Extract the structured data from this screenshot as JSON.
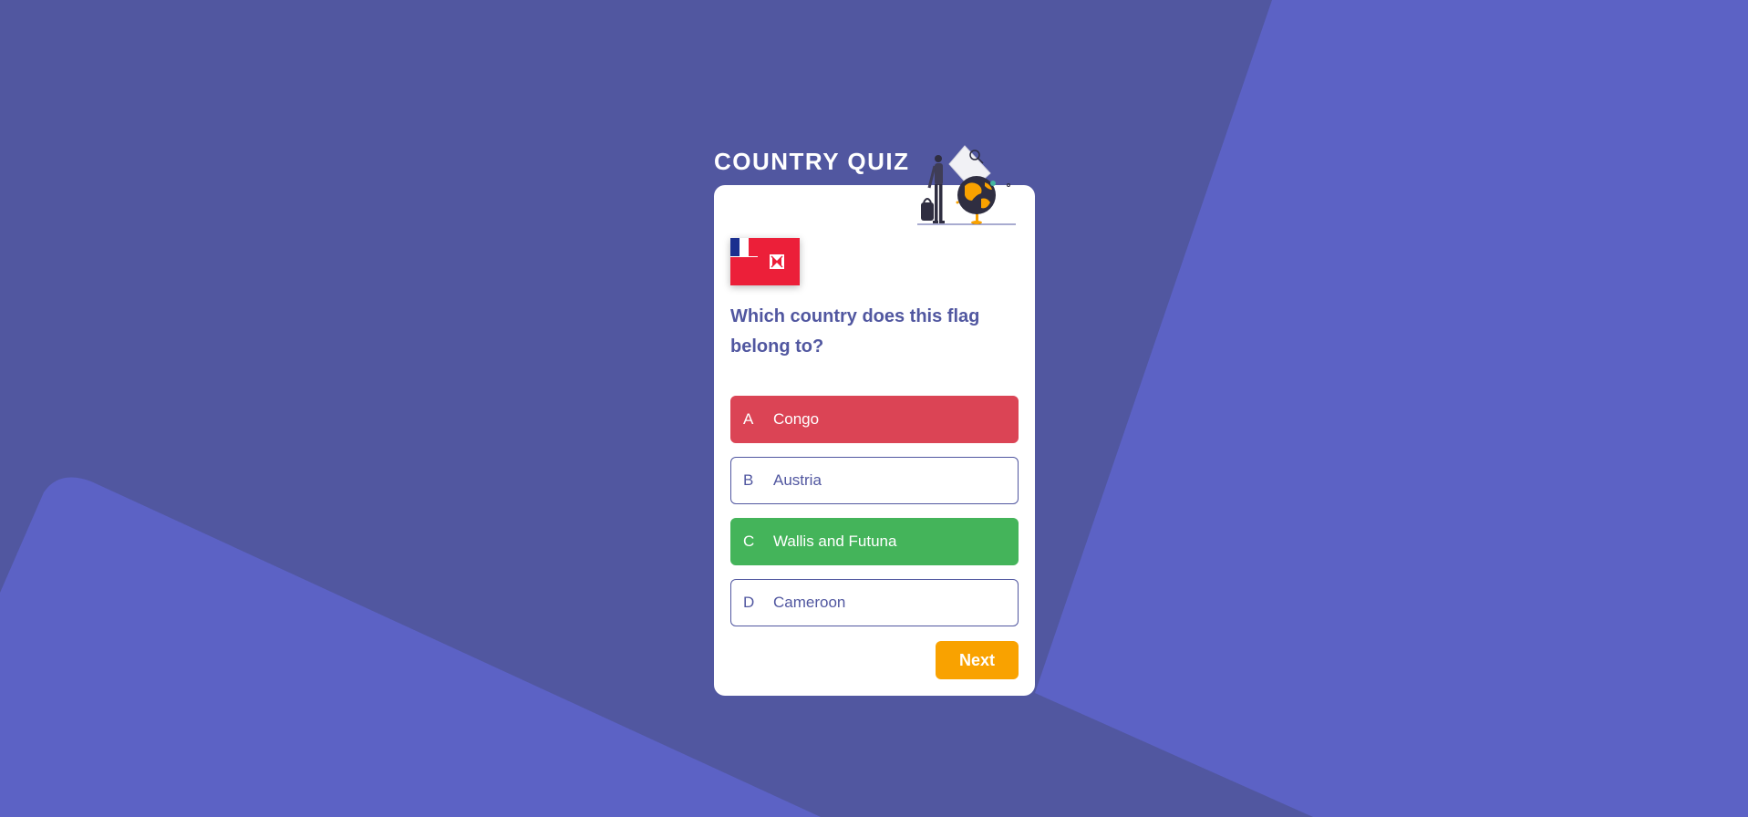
{
  "app": {
    "title": "COUNTRY QUIZ"
  },
  "colors": {
    "background": "#5157a0",
    "background_shape": "#5c62c5",
    "card": "#ffffff",
    "text_primary": "#5157a0",
    "wrong": "#db4455",
    "correct": "#44b45a",
    "next_button": "#f9a200"
  },
  "question": {
    "text": "Which country does this flag belong to?",
    "flag_icon": "wallis-and-futuna-flag-icon"
  },
  "options": [
    {
      "letter": "A",
      "label": "Congo",
      "state": "wrong"
    },
    {
      "letter": "B",
      "label": "Austria",
      "state": "default"
    },
    {
      "letter": "C",
      "label": "Wallis and Futuna",
      "state": "correct"
    },
    {
      "letter": "D",
      "label": "Cameroon",
      "state": "default"
    }
  ],
  "actions": {
    "next_label": "Next"
  },
  "illustration_icon": "traveler-with-globe-icon"
}
